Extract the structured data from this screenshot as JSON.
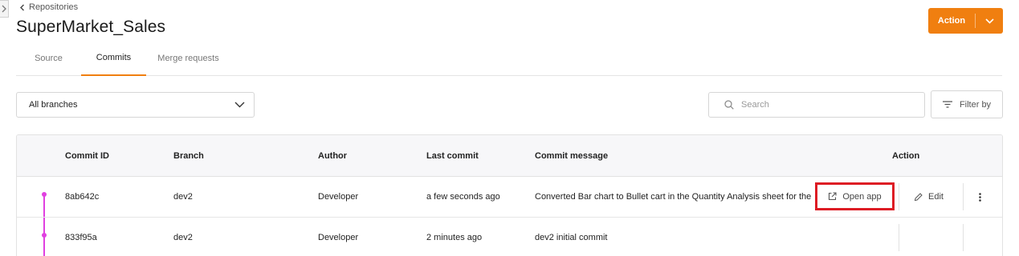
{
  "breadcrumb": {
    "label": "Repositories"
  },
  "page": {
    "title": "SuperMarket_Sales"
  },
  "action_button": {
    "label": "Action"
  },
  "tabs": [
    {
      "label": "Source",
      "active": false
    },
    {
      "label": "Commits",
      "active": true
    },
    {
      "label": "Merge requests",
      "active": false
    }
  ],
  "branch_filter": {
    "value": "All branches"
  },
  "search": {
    "placeholder": "Search",
    "value": ""
  },
  "filter_button": {
    "label": "Filter by"
  },
  "table": {
    "columns": [
      "Commit ID",
      "Branch",
      "Author",
      "Last commit",
      "Commit message",
      "Action"
    ],
    "rows": [
      {
        "commit_id": "8ab642c",
        "branch": "dev2",
        "author": "Developer",
        "last_commit": "a few seconds ago",
        "message": "Converted Bar chart to Bullet cart in the Quantity Analysis sheet for the",
        "open_app_label": "Open app",
        "edit_label": "Edit"
      },
      {
        "commit_id": "833f95a",
        "branch": "dev2",
        "author": "Developer",
        "last_commit": "2 minutes ago",
        "message": "dev2 initial commit"
      }
    ]
  },
  "colors": {
    "accent": "#f07f10",
    "graph": "#e040e0",
    "highlight": "#dd1c24"
  }
}
